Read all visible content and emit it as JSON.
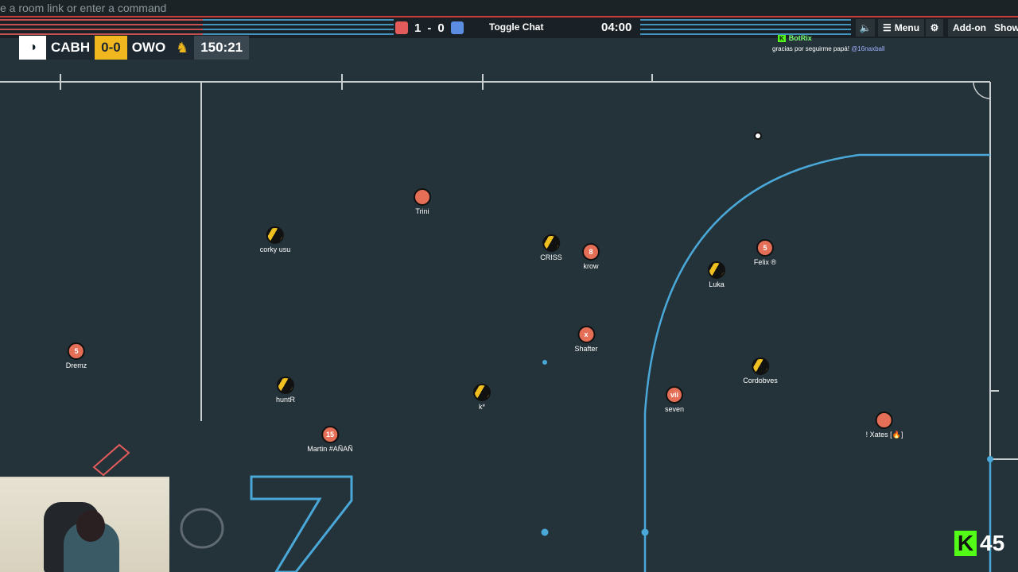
{
  "command_bar": {
    "placeholder": "e a room link or enter a command"
  },
  "topbar": {
    "score_red": "1",
    "score_sep": "-",
    "score_blue": "0",
    "toggle_chat": "Toggle Chat",
    "timer": "04:00",
    "volume_icon": "volume-icon",
    "menu_label": "Menu",
    "add_on_label": "Add-on",
    "show_label": "Show",
    "colors": {
      "red": "#e35b5b",
      "blue": "#5b8de3"
    }
  },
  "scorebug": {
    "team_home": "CABH",
    "result": "0-0",
    "team_away": "OWO",
    "clock": "150:21"
  },
  "chat": {
    "user": "BotRix",
    "message": "gracias por seguirme papá!",
    "mention": "@16naxball"
  },
  "players": [
    {
      "name": "Trini",
      "team": "red",
      "label": ""
    },
    {
      "name": "corky usu",
      "team": "yellow",
      "label": ""
    },
    {
      "name": "CRISS",
      "team": "yellow",
      "label": ""
    },
    {
      "name": "krow",
      "team": "red",
      "label": "8"
    },
    {
      "name": "Felix ®",
      "team": "red",
      "label": "5"
    },
    {
      "name": "Luka",
      "team": "yellow",
      "label": ""
    },
    {
      "name": "Dremz",
      "team": "red",
      "label": "5"
    },
    {
      "name": "Shafter",
      "team": "red",
      "label": "x"
    },
    {
      "name": "huntR",
      "team": "yellow",
      "label": ""
    },
    {
      "name": "k*",
      "team": "yellow",
      "label": ""
    },
    {
      "name": "Cordobves",
      "team": "yellow",
      "label": ""
    },
    {
      "name": "seven",
      "team": "red",
      "label": "vii"
    },
    {
      "name": "Martin #AÑAÑ",
      "team": "red",
      "label": "15"
    },
    {
      "name": "! Xates [🔥]",
      "team": "red",
      "label": ""
    }
  ],
  "kick_badge": {
    "logo": "K",
    "count": "45"
  }
}
